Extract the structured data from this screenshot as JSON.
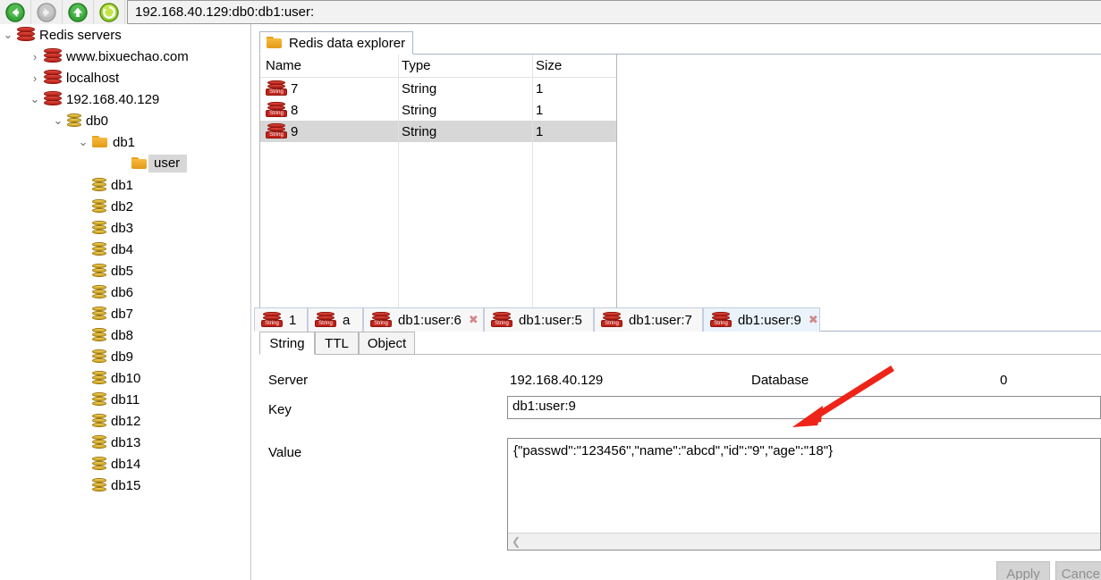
{
  "toolbar": {
    "back_icon": "arrow-left-circle-icon",
    "forward_icon": "arrow-right-circle-icon",
    "up_icon": "arrow-up-circle-icon",
    "refresh_icon": "refresh-circle-icon",
    "address": "192.168.40.129:db0:db1:user:"
  },
  "sidebar": {
    "items": [
      {
        "label": "Redis servers",
        "indent": 0,
        "icon": "redis-icon",
        "twisty": "⌄",
        "selected": false
      },
      {
        "label": "www.bixuechao.com",
        "indent": 30,
        "icon": "redis-icon",
        "twisty": "›",
        "selected": false
      },
      {
        "label": "localhost",
        "indent": 30,
        "icon": "redis-icon",
        "twisty": "›",
        "selected": false
      },
      {
        "label": "192.168.40.129",
        "indent": 30,
        "icon": "redis-icon",
        "twisty": "⌄",
        "selected": false
      },
      {
        "label": "db0",
        "indent": 56,
        "icon": "database-icon",
        "twisty": "⌄",
        "selected": false
      },
      {
        "label": "db1",
        "indent": 84,
        "icon": "folder-icon",
        "twisty": "⌄",
        "selected": false
      },
      {
        "label": "user",
        "indent": 128,
        "icon": "folder-icon",
        "twisty": "",
        "selected": true
      },
      {
        "label": "db1",
        "indent": 84,
        "icon": "database-icon",
        "twisty": "",
        "selected": false
      },
      {
        "label": "db2",
        "indent": 84,
        "icon": "database-icon",
        "twisty": "",
        "selected": false
      },
      {
        "label": "db3",
        "indent": 84,
        "icon": "database-icon",
        "twisty": "",
        "selected": false
      },
      {
        "label": "db4",
        "indent": 84,
        "icon": "database-icon",
        "twisty": "",
        "selected": false
      },
      {
        "label": "db5",
        "indent": 84,
        "icon": "database-icon",
        "twisty": "",
        "selected": false
      },
      {
        "label": "db6",
        "indent": 84,
        "icon": "database-icon",
        "twisty": "",
        "selected": false
      },
      {
        "label": "db7",
        "indent": 84,
        "icon": "database-icon",
        "twisty": "",
        "selected": false
      },
      {
        "label": "db8",
        "indent": 84,
        "icon": "database-icon",
        "twisty": "",
        "selected": false
      },
      {
        "label": "db9",
        "indent": 84,
        "icon": "database-icon",
        "twisty": "",
        "selected": false
      },
      {
        "label": "db10",
        "indent": 84,
        "icon": "database-icon",
        "twisty": "",
        "selected": false
      },
      {
        "label": "db11",
        "indent": 84,
        "icon": "database-icon",
        "twisty": "",
        "selected": false
      },
      {
        "label": "db12",
        "indent": 84,
        "icon": "database-icon",
        "twisty": "",
        "selected": false
      },
      {
        "label": "db13",
        "indent": 84,
        "icon": "database-icon",
        "twisty": "",
        "selected": false
      },
      {
        "label": "db14",
        "indent": 84,
        "icon": "database-icon",
        "twisty": "",
        "selected": false
      },
      {
        "label": "db15",
        "indent": 84,
        "icon": "database-icon",
        "twisty": "",
        "selected": false
      }
    ]
  },
  "explorer": {
    "tab_label": "Redis data explorer",
    "tab_icon": "folder-icon",
    "columns": [
      "Name",
      "Type",
      "Size"
    ],
    "rows": [
      {
        "name": "7",
        "type": "String",
        "size": "1",
        "icon": "string-key-icon",
        "selected": false
      },
      {
        "name": "8",
        "type": "String",
        "size": "1",
        "icon": "string-key-icon",
        "selected": false
      },
      {
        "name": "9",
        "type": "String",
        "size": "1",
        "icon": "string-key-icon",
        "selected": true
      }
    ]
  },
  "key_tabs": [
    {
      "label": "1",
      "icon": "string-key-icon",
      "closable": false,
      "active": false
    },
    {
      "label": "a",
      "icon": "string-key-icon",
      "closable": false,
      "active": false
    },
    {
      "label": "db1:user:6",
      "icon": "string-key-icon",
      "closable": true,
      "active": false
    },
    {
      "label": "db1:user:5",
      "icon": "string-key-icon",
      "closable": false,
      "active": false
    },
    {
      "label": "db1:user:7",
      "icon": "string-key-icon",
      "closable": false,
      "active": false
    },
    {
      "label": "db1:user:9",
      "icon": "string-key-icon",
      "closable": true,
      "active": true
    }
  ],
  "detail": {
    "subtabs": [
      {
        "label": "String",
        "active": true
      },
      {
        "label": "TTL",
        "active": false
      },
      {
        "label": "Object",
        "active": false
      }
    ],
    "server_label": "Server",
    "server_value": "192.168.40.129",
    "database_label": "Database",
    "database_value": "0",
    "key_label": "Key",
    "key_value": "db1:user:9",
    "value_label": "Value",
    "value_text": "{\"passwd\":\"123456\",\"name\":\"abcd\",\"id\":\"9\",\"age\":\"18\"}",
    "scroll_left_icon": "chevron-left-icon",
    "apply_label": "Apply",
    "cancel_label": "Cancel"
  },
  "annotation": {
    "arrow_color": "#ee2418",
    "arrow_icon": "red-pointer-arrow-icon"
  },
  "close_glyph": "✖"
}
